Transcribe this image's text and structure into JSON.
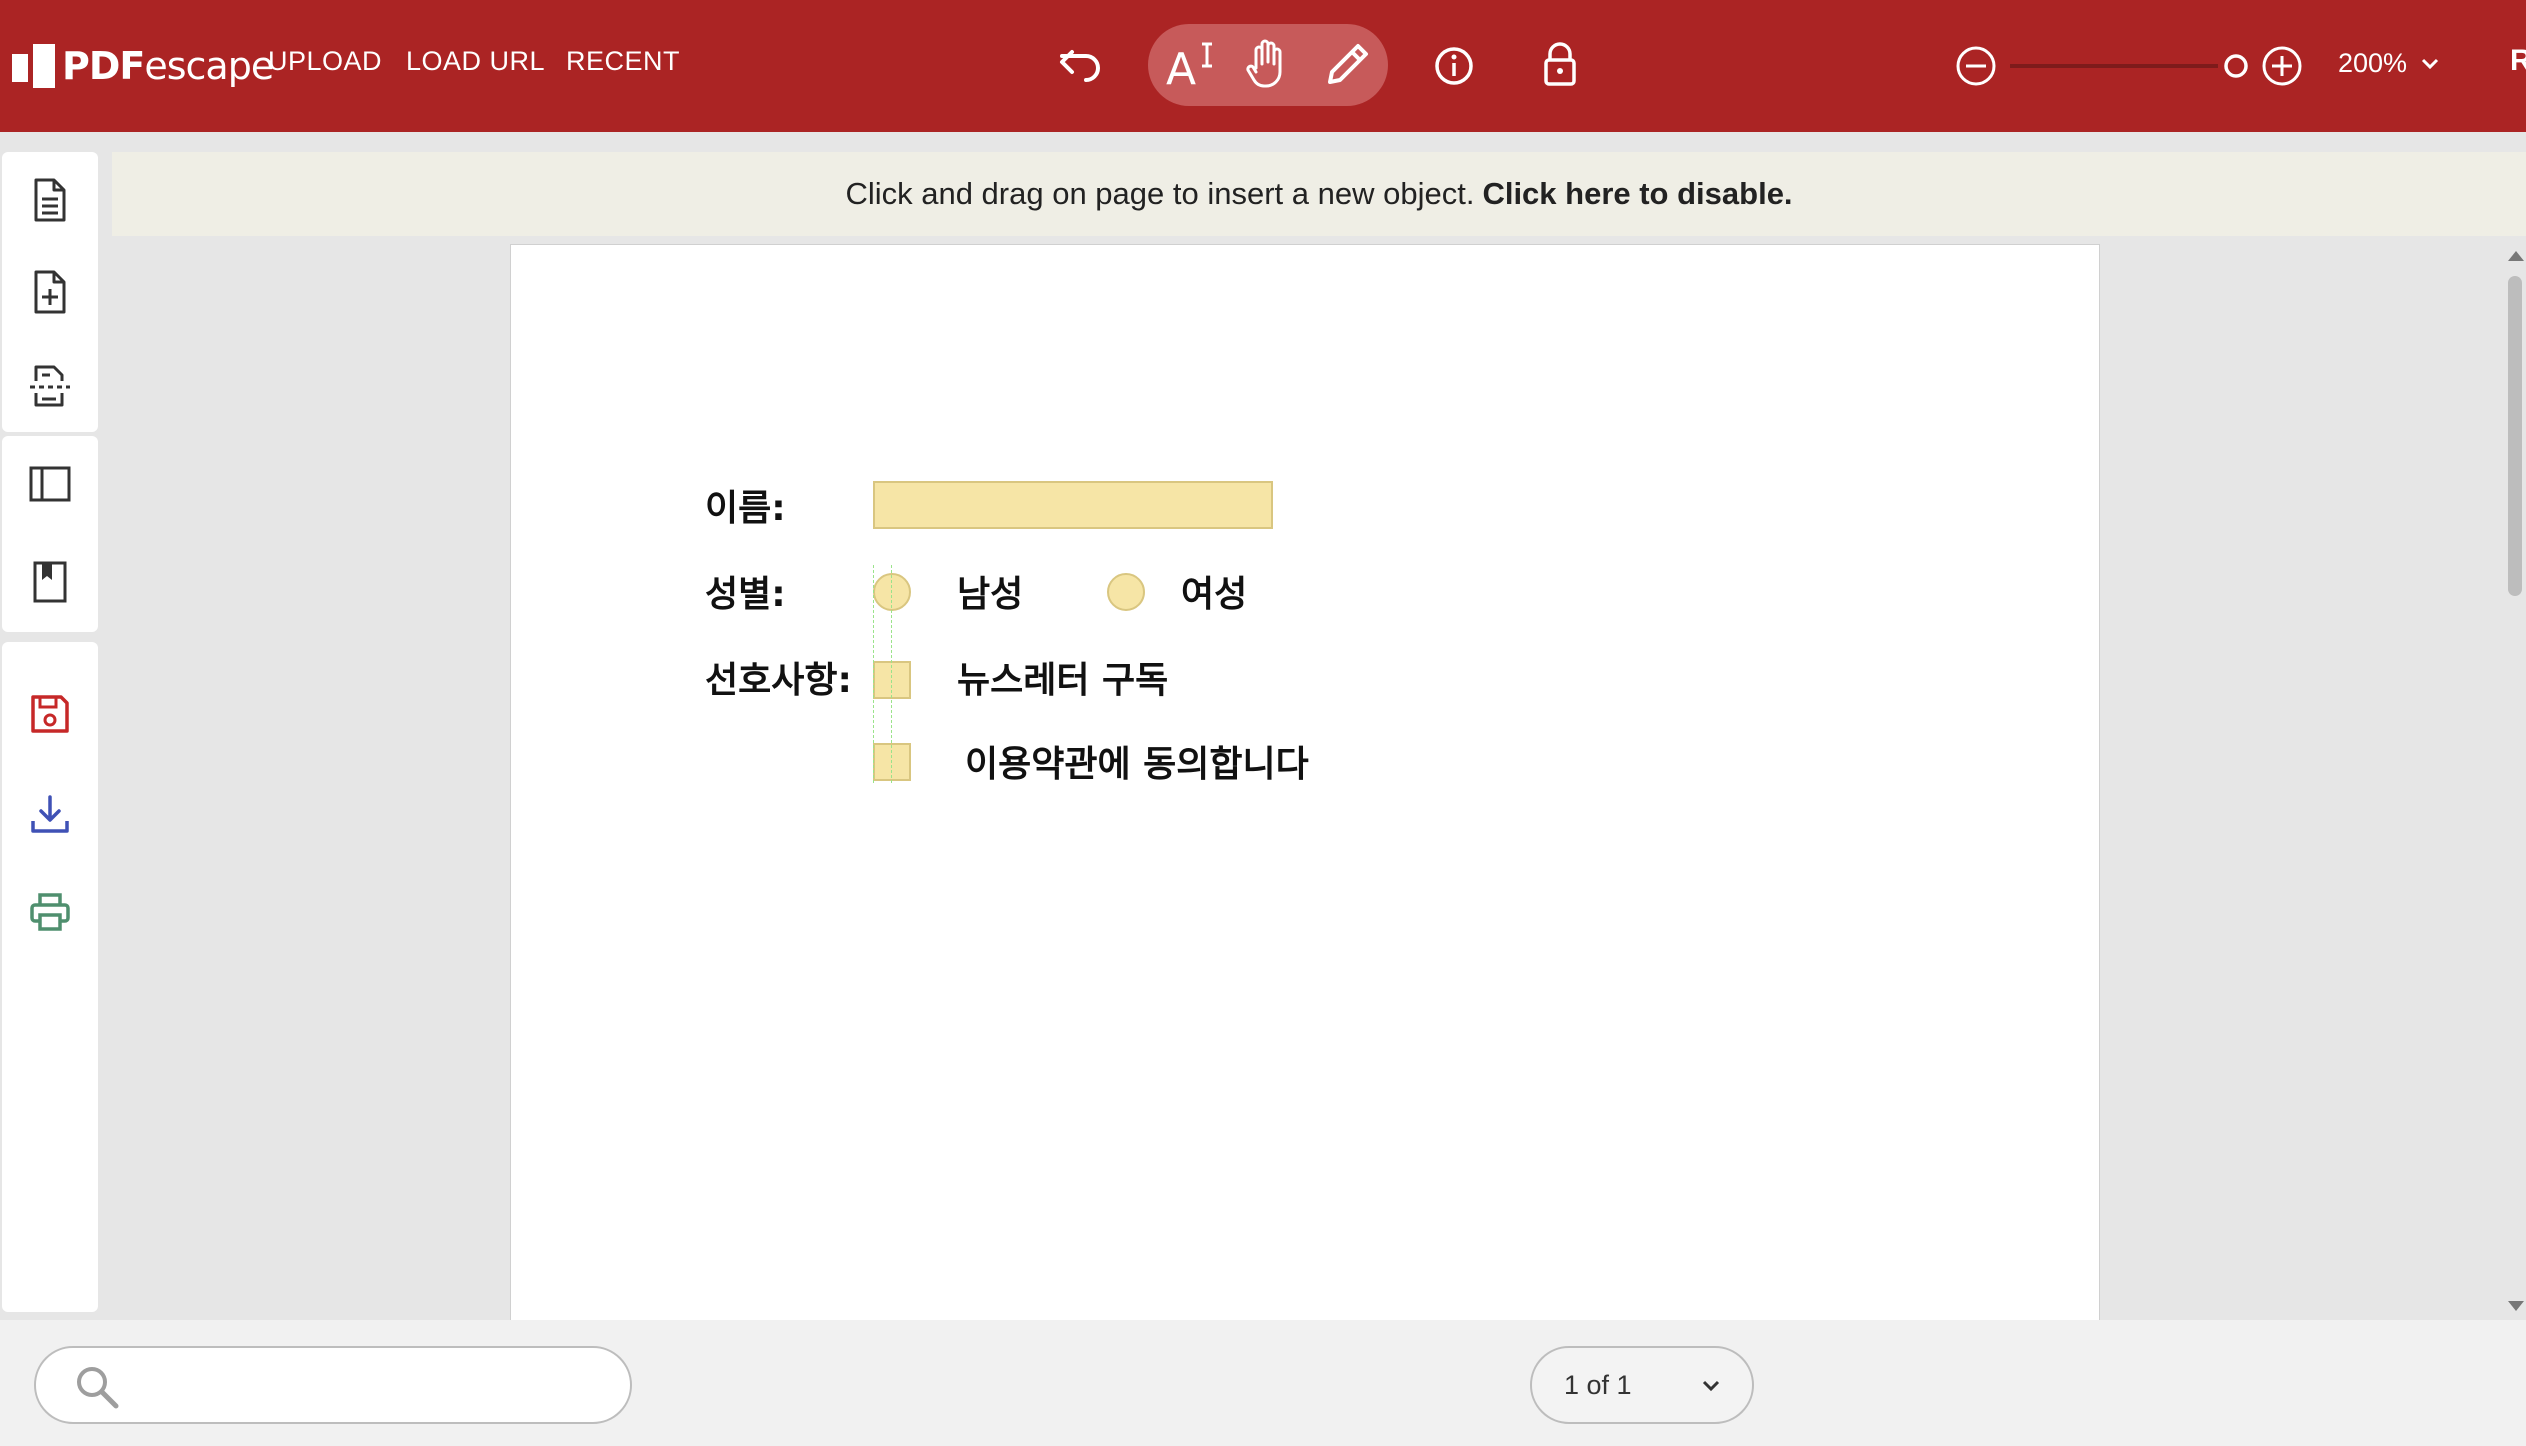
{
  "app": {
    "logo_bold": "PDF",
    "logo_light": "escape",
    "nav": [
      "UPLOAD",
      "LOAD URL",
      "RECENT"
    ],
    "zoom_level": "200%",
    "cut_off_letter": "R"
  },
  "toolbar_icons": [
    "undo-icon",
    "text-tool-icon",
    "hand-tool-icon",
    "pencil-icon",
    "info-icon",
    "lock-icon",
    "zoom-out-icon",
    "zoom-in-icon",
    "chevron-down-icon"
  ],
  "sidebar_icons": [
    "document-icon",
    "add-page-icon",
    "split-page-icon",
    "panel-icon",
    "bookmark-icon",
    "save-icon",
    "download-icon",
    "print-icon"
  ],
  "notice": {
    "text": "Click and drag on page to insert a new object.",
    "link": "Click here to disable."
  },
  "form": {
    "name_label": "이름:",
    "gender_label": "성별:",
    "male": "남성",
    "female": "여성",
    "prefs_label": "선호사항:",
    "newsletter": "뉴스레터 구독",
    "terms": "이용약관에 동의합니다"
  },
  "search": {
    "placeholder": ""
  },
  "pager": {
    "label": "1 of 1"
  },
  "colors": {
    "brand": "#ab2424",
    "field": "#f6e5a6"
  }
}
